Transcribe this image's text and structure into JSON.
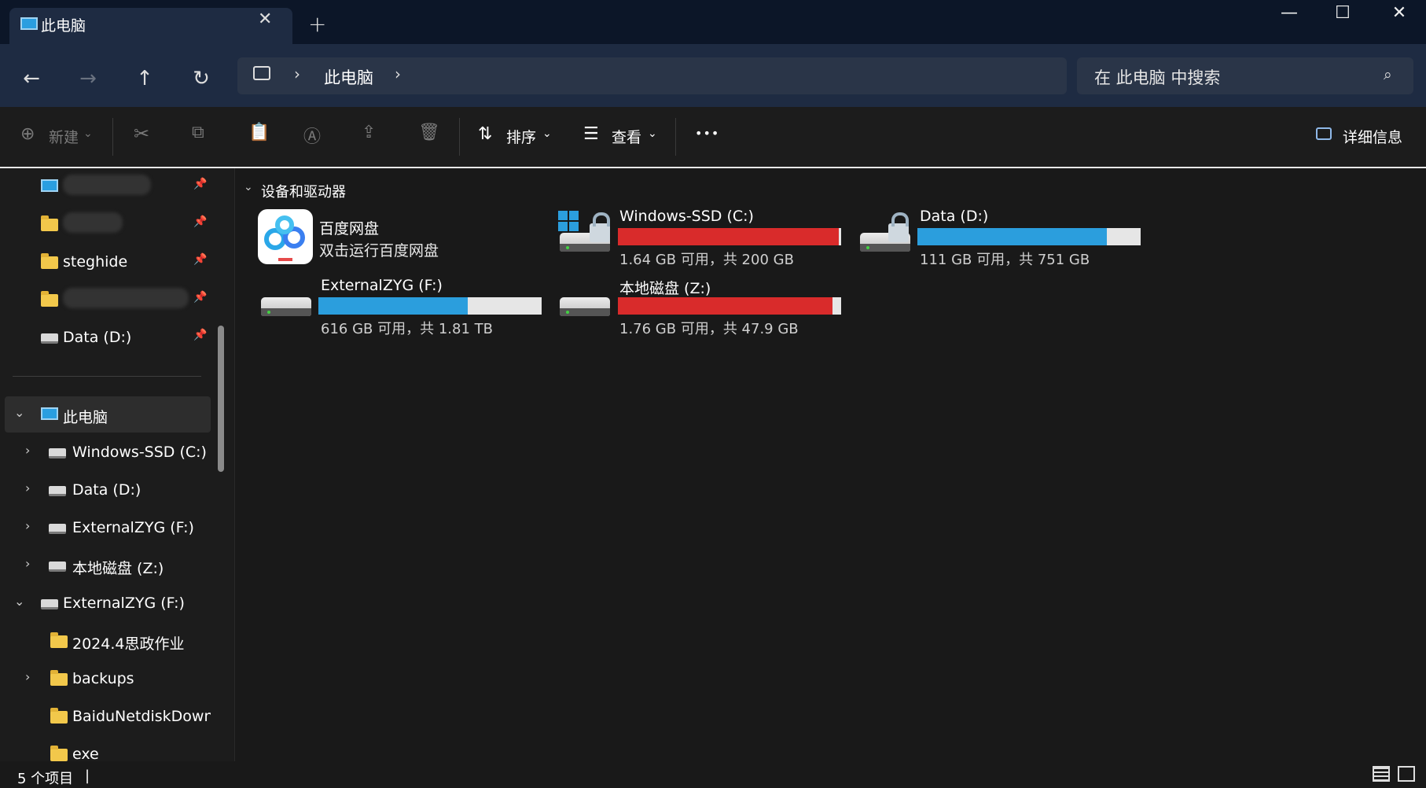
{
  "window": {
    "tab_title": "此电脑",
    "new_tab": "+",
    "minimize": "—",
    "maximize": "☐",
    "close": "✕"
  },
  "nav": {
    "breadcrumb": [
      "此电脑"
    ],
    "search_placeholder": "在 此电脑 中搜索"
  },
  "toolbar": {
    "new_label": "新建",
    "sort_label": "排序",
    "view_label": "查看",
    "more_label": "•••",
    "details_label": "详细信息"
  },
  "sidebar": {
    "pinned": [
      {
        "label": "steghide"
      },
      {
        "label": "Data (D:)"
      }
    ],
    "tree": [
      {
        "label": "此电脑"
      },
      {
        "label": "Windows-SSD (C:)"
      },
      {
        "label": "Data (D:)"
      },
      {
        "label": "ExternalZYG (F:)"
      },
      {
        "label": "本地磁盘 (Z:)"
      },
      {
        "label": "ExternalZYG (F:)"
      },
      {
        "label": "2024.4思政作业"
      },
      {
        "label": "backups"
      },
      {
        "label": "BaiduNetdiskDownlo"
      },
      {
        "label": "exe"
      }
    ]
  },
  "content": {
    "group_title": "设备和驱动器",
    "app": {
      "name": "百度网盘",
      "desc": "双击运行百度网盘"
    },
    "drives": [
      {
        "name": "Windows-SSD (C:)",
        "free_text": "1.64 GB 可用，共 200 GB",
        "used_fraction": 0.99,
        "color": "#d92b2b"
      },
      {
        "name": "Data (D:)",
        "free_text": "111 GB 可用，共 751 GB",
        "used_fraction": 0.85,
        "color": "#2b9edd"
      },
      {
        "name": "ExternalZYG (F:)",
        "free_text": "616 GB 可用，共 1.81 TB",
        "used_fraction": 0.67,
        "color": "#2b9edd"
      },
      {
        "name": "本地磁盘 (Z:)",
        "free_text": "1.76 GB 可用，共 47.9 GB",
        "used_fraction": 0.96,
        "color": "#d92b2b"
      }
    ]
  },
  "status": {
    "item_count": "5 个项目"
  }
}
